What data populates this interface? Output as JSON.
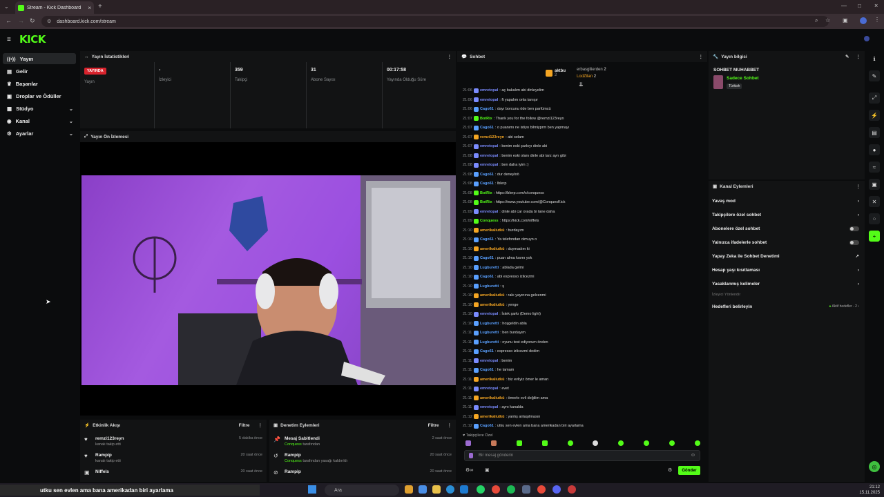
{
  "browser": {
    "tab_title": "Stream - Kick Dashboard",
    "url": "dashboard.kick.com/stream"
  },
  "brand": {
    "logo": "KICK",
    "accent": "#53fc18"
  },
  "sidebar": {
    "items": [
      {
        "label": "Yayın",
        "icon": "broadcast-icon"
      },
      {
        "label": "Gelir",
        "icon": "money-icon"
      },
      {
        "label": "Başarılar",
        "icon": "trophy-icon"
      },
      {
        "label": "Droplar ve Ödüller",
        "icon": "gift-icon"
      },
      {
        "label": "Stüdyo",
        "icon": "studio-icon"
      },
      {
        "label": "Kanal",
        "icon": "channel-icon"
      },
      {
        "label": "Ayarlar",
        "icon": "gear-icon"
      }
    ]
  },
  "stats": {
    "title": "Yayın İstatistikleri",
    "live_badge": "YAYINDA",
    "cells": [
      {
        "value": "",
        "label": "Yayın"
      },
      {
        "value": "-",
        "label": "İzleyici"
      },
      {
        "value": "359",
        "label": "Takipçi"
      },
      {
        "value": "31",
        "label": "Abone Sayısı"
      },
      {
        "value": "00:17:58",
        "label": "Yayında Olduğu Süre"
      }
    ]
  },
  "preview": {
    "title": "Yayın Ön İzlemesi"
  },
  "activity": {
    "title": "Etkinlik Akışı",
    "filter": "Filtre",
    "rows": [
      {
        "name": "remzi123reyn",
        "sub": "kanalı takip etti",
        "time": "5 dakika önce"
      },
      {
        "name": "Rampip",
        "sub": "kanalı takip etti",
        "time": "20 saat önce"
      },
      {
        "name": "Niffels",
        "sub": "",
        "time": "20 saat önce"
      }
    ]
  },
  "moderation": {
    "title": "Denetim Eylemleri",
    "filter": "Filtre",
    "rows": [
      {
        "name": "Mesaj Sabitlendi",
        "by": "Conquess",
        "sub": "tarafından",
        "time": "2 saat önce"
      },
      {
        "name": "Rampip",
        "by": "Conquess",
        "sub": "tarafından yasağı kaldırıldı",
        "time": "20 saat önce"
      },
      {
        "name": "Rampip",
        "by": "",
        "sub": "",
        "time": "20 saat önce"
      }
    ]
  },
  "chat": {
    "title": "Sohbet",
    "top_user_1": "aktbu",
    "top_user_1_count": "2",
    "top_user_2": "erbasgilierden",
    "top_user_2_count": "2",
    "top_user_3": "LodZilan",
    "top_user_3_count": "2",
    "messages": [
      {
        "t": "21:06",
        "u": "emretopal",
        "c": "#7b8cff",
        "m": ": aç bakalım abi dinleyelim"
      },
      {
        "t": "21:06",
        "u": "emretopal",
        "c": "#7b8cff",
        "m": ": ft yapalım onla tanışır"
      },
      {
        "t": "21:06",
        "u": "Cago61",
        "c": "#5aa0ff",
        "m": ": dayı borcunu öde ben parfümcü"
      },
      {
        "t": "21:07",
        "u": "BotRix",
        "c": "#53fc18",
        "m": ": Thank you for the follow @remzi123reyn"
      },
      {
        "t": "21:07",
        "u": "Cago61",
        "c": "#5aa0ff",
        "m": ": o puanımı ne istiyo bilmiyprm ben yapmayı"
      },
      {
        "t": "21:07",
        "u": "remzi123reyn",
        "c": "#f5a623",
        "m": ": abi selam"
      },
      {
        "t": "21:07",
        "u": "emretopal",
        "c": "#7b8cff",
        "m": ": benim eski şarkıyı dinle abi"
      },
      {
        "t": "21:08",
        "u": "emretopal",
        "c": "#7b8cff",
        "m": ": benim eski olanı dinle abi tarz ayrı gibi"
      },
      {
        "t": "21:08",
        "u": "emretopal",
        "c": "#7b8cff",
        "m": ": ben daha iyim :)"
      },
      {
        "t": "21:08",
        "u": "Cago61",
        "c": "#5aa0ff",
        "m": ": dur deneyloö"
      },
      {
        "t": "21:08",
        "u": "Cago61",
        "c": "#5aa0ff",
        "m": ": lblerp"
      },
      {
        "t": "21:08",
        "u": "BotRix",
        "c": "#53fc18",
        "m": ": https://blerp.com/x/conquess"
      },
      {
        "t": "21:08",
        "u": "BotRix",
        "c": "#53fc18",
        "m": ": https://www.youtube.com/@ConquesKick"
      },
      {
        "t": "21:09",
        "u": "emretopal",
        "c": "#7b8cff",
        "m": ": dinle abi car orada bi tane daha"
      },
      {
        "t": "21:09",
        "u": "Conquess",
        "c": "#53fc18",
        "m": ": https://kick.com/niffels"
      },
      {
        "t": "21:10",
        "u": "amerikaliutkü",
        "c": "#f5a623",
        "m": ": burdayım"
      },
      {
        "t": "21:10",
        "u": "Cago61",
        "c": "#5aa0ff",
        "m": ": Ya telefondan olmuyo o"
      },
      {
        "t": "21:10",
        "u": "amerikaliutkü",
        "c": "#f5a623",
        "m": ": duymadım ki"
      },
      {
        "t": "21:10",
        "u": "Cago61",
        "c": "#5aa0ff",
        "m": ": puan alma kısmı yok"
      },
      {
        "t": "21:10",
        "u": "Lugburetti",
        "c": "#5aa0ff",
        "m": ": ablada gelmi"
      },
      {
        "t": "21:10",
        "u": "Cago61",
        "c": "#5aa0ff",
        "m": ": abi espresso izlicezmi"
      },
      {
        "t": "21:10",
        "u": "Lugburetti",
        "c": "#5aa0ff",
        "m": ": ş"
      },
      {
        "t": "21:10",
        "u": "amerikaliutkü",
        "c": "#f5a623",
        "m": ": rakı yayınına gelcenmi"
      },
      {
        "t": "21:10",
        "u": "amerikaliutkü",
        "c": "#f5a623",
        "m": ": yenge"
      },
      {
        "t": "21:10",
        "u": "emretopal",
        "c": "#7b8cff",
        "m": ": İstek şarkı (Demo light)"
      },
      {
        "t": "21:10",
        "u": "Lugburetti",
        "c": "#5aa0ff",
        "m": ": hoşgeldin abla"
      },
      {
        "t": "21:11",
        "u": "Lugburetti",
        "c": "#5aa0ff",
        "m": ": ben burdayım"
      },
      {
        "t": "21:11",
        "u": "Lugburetti",
        "c": "#5aa0ff",
        "m": ": oyunu test ediyorum önden"
      },
      {
        "t": "21:11",
        "u": "Cago61",
        "c": "#5aa0ff",
        "m": ": espresso izlicezmi dedim"
      },
      {
        "t": "21:11",
        "u": "emretopal",
        "c": "#7b8cff",
        "m": ": benim"
      },
      {
        "t": "21:11",
        "u": "Cago61",
        "c": "#5aa0ff",
        "m": ": he tamam"
      },
      {
        "t": "21:11",
        "u": "amerikaliutkü",
        "c": "#f5a623",
        "m": ": biz evliyiz ömer le aman"
      },
      {
        "t": "21:11",
        "u": "emretopal",
        "c": "#7b8cff",
        "m": ": evet"
      },
      {
        "t": "21:11",
        "u": "amerikaliutkü",
        "c": "#f5a623",
        "m": ": ömerle evli değilim ama"
      },
      {
        "t": "21:11",
        "u": "emretopal",
        "c": "#7b8cff",
        "m": ": aynı kanalda"
      },
      {
        "t": "21:12",
        "u": "amerikaliutkü",
        "c": "#f5a623",
        "m": ": yanlış anlaşılmasın"
      },
      {
        "t": "21:12",
        "u": "Cago61",
        "c": "#5aa0ff",
        "m": ": utku sen evlen ama bana amerikadan biri ayarlama"
      }
    ],
    "followers_only": "Takipçilere Özel",
    "input_placeholder": "Bir mesaj gönderin",
    "send_label": "Gönder"
  },
  "info": {
    "title": "Yayın bilgisi",
    "category_title": "SOHBET MUHABBET",
    "category": "Sadece Sohbet",
    "tag": "Türkish"
  },
  "actions": {
    "title": "Kanal Eylemleri",
    "items": [
      {
        "label": "Yavaş mod",
        "ctrl": "chevron"
      },
      {
        "label": "Takipçilere özel sohbet",
        "ctrl": "chevron"
      },
      {
        "label": "Abonelere özel sohbet",
        "ctrl": "toggle"
      },
      {
        "label": "Yalnızca ifadelerle sohbet",
        "ctrl": "toggle"
      },
      {
        "label": "Yapay Zeka ile Sohbet Denetimi",
        "ctrl": "external"
      },
      {
        "label": "Hesap yaşı kısıtlaması",
        "ctrl": "chevron"
      },
      {
        "label": "Yasaklanmış kelimeler",
        "ctrl": "chevron"
      }
    ],
    "section": "İzleyici Yönlendir",
    "goals_label": "Hedefleri belirleyin",
    "goals_status": "Aktif hedefler - 2"
  },
  "taskbar": {
    "ticker": "utku sen evlen ama bana amerikadan biri ayarlama",
    "search": "Ara",
    "time": "21:12",
    "date": "15.11.2025"
  }
}
